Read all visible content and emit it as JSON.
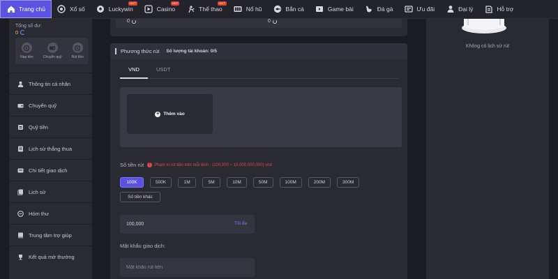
{
  "nav": {
    "items": [
      {
        "label": "Trang chủ",
        "icon": "home-icon",
        "hot": false,
        "active": true
      },
      {
        "label": "Xổ số",
        "icon": "lottery-ball-icon",
        "hot": false,
        "active": false
      },
      {
        "label": "Luckywin",
        "icon": "soccer-ball-icon",
        "hot": true,
        "active": false
      },
      {
        "label": "Casino",
        "icon": "play-icon",
        "hot": true,
        "active": false
      },
      {
        "label": "Thể thao",
        "icon": "sports-icon",
        "hot": true,
        "active": false
      },
      {
        "label": "Nổ hũ",
        "icon": "slot-icon",
        "hot": false,
        "active": false
      },
      {
        "label": "Bắn cá",
        "icon": "fish-icon",
        "hot": false,
        "active": false
      },
      {
        "label": "Game bài",
        "icon": "cards-icon",
        "hot": false,
        "active": false
      },
      {
        "label": "Đá gà",
        "icon": "rooster-icon",
        "hot": false,
        "active": false
      },
      {
        "label": "Ưu đãi",
        "icon": "gift-icon",
        "hot": false,
        "active": false
      },
      {
        "label": "Đại lý",
        "icon": "agent-icon",
        "hot": false,
        "active": false
      },
      {
        "label": "Hỗ trợ",
        "icon": "support-icon",
        "hot": false,
        "active": false
      }
    ],
    "hot_badge": "HOT"
  },
  "sidebar": {
    "balance_label": "Tổng số dư:",
    "balance_value": "0",
    "quick_actions": [
      {
        "label": "Nạp tiền",
        "icon": "deposit-icon"
      },
      {
        "label": "Chuyển quỹ",
        "icon": "transfer-icon"
      },
      {
        "label": "Rút tiền",
        "icon": "withdraw-icon"
      }
    ],
    "menu": [
      {
        "label": "Thông tin cá nhân",
        "icon": "user-icon"
      },
      {
        "label": "Chuyển quỹ",
        "icon": "wallet-icon"
      },
      {
        "label": "Quỹ tiền",
        "icon": "fund-icon"
      },
      {
        "label": "Lịch sử thắng thua",
        "icon": "history-icon"
      },
      {
        "label": "Chi tiết giao dịch",
        "icon": "transaction-icon"
      },
      {
        "label": "Lịch sử",
        "icon": "log-icon"
      },
      {
        "label": "Hòm thư",
        "icon": "mail-icon"
      },
      {
        "label": "Trung tâm trợ giúp",
        "icon": "help-icon"
      },
      {
        "label": "Kết quả mở thưởng",
        "icon": "trophy-icon"
      }
    ]
  },
  "top_card": {
    "left_value": "0",
    "right_value": "0"
  },
  "withdraw": {
    "title": "Phương thức rút",
    "account_count": "Số lượng tài khoản: 0/5",
    "tabs": [
      "VND",
      "USDT"
    ],
    "add_label": "Thêm vào",
    "amount_label": "Số tiền rút",
    "amount_note": "Phạm vi rút tiền trên mỗi lệnh : (100,000 ~ 10,000,000,000) vnd",
    "chips": [
      "100K",
      "500K",
      "1M",
      "5M",
      "10M",
      "50M",
      "100M",
      "200M",
      "300M"
    ],
    "chip_other": "Số tiền khác",
    "amount_value": "100,000",
    "max_label": "Tối đa",
    "password_label": "Mật khẩu giao dịch:",
    "password_placeholder": "Mật khẩu rút tiền"
  },
  "history": {
    "empty_text": "Không có lịch sử rút"
  },
  "colors": {
    "accent": "#5b52e0",
    "background": "#1b1b22",
    "panel": "#2a2a33",
    "warning": "#e24a4a"
  }
}
